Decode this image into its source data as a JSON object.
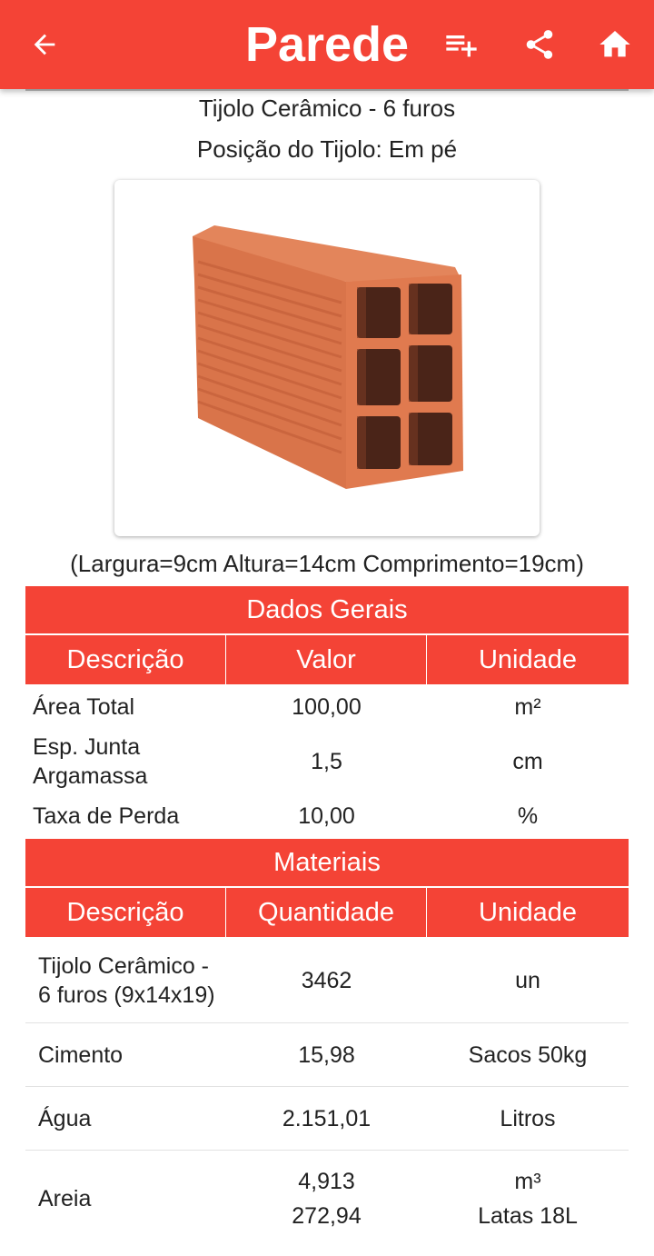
{
  "appbar": {
    "title": "Parede",
    "back_icon": "arrow-left-icon",
    "add_list_icon": "playlist-add-icon",
    "share_icon": "share-icon",
    "home_icon": "home-icon"
  },
  "brick": {
    "name": "Tijolo Cerâmico - 6 furos",
    "position": "Posição do Tijolo: Em pé",
    "dimensions": "(Largura=9cm Altura=14cm Comprimento=19cm)"
  },
  "dados_gerais": {
    "title": "Dados Gerais",
    "headers": [
      "Descrição",
      "Valor",
      "Unidade"
    ],
    "rows": [
      {
        "desc": "Área Total",
        "value": "100,00",
        "unit": "m²"
      },
      {
        "desc": "Esp. Junta Argamassa",
        "value": "1,5",
        "unit": "cm"
      },
      {
        "desc": "Taxa de Perda",
        "value": "10,00",
        "unit": "%"
      }
    ]
  },
  "materiais": {
    "title": "Materiais",
    "headers": [
      "Descrição",
      "Quantidade",
      "Unidade"
    ],
    "rows": [
      {
        "desc": "Tijolo Cerâmico - 6 furos (9x14x19)",
        "qty": "3462",
        "unit": "un"
      },
      {
        "desc": "Cimento",
        "qty": "15,98",
        "unit": "Sacos 50kg"
      },
      {
        "desc": "Água",
        "qty": "2.151,01",
        "unit": "Litros"
      },
      {
        "desc": "Areia",
        "qty": "4,913",
        "qty2": "272,94",
        "unit": "m³",
        "unit2": "Latas 18L"
      }
    ]
  },
  "colors": {
    "accent": "#f44336"
  }
}
